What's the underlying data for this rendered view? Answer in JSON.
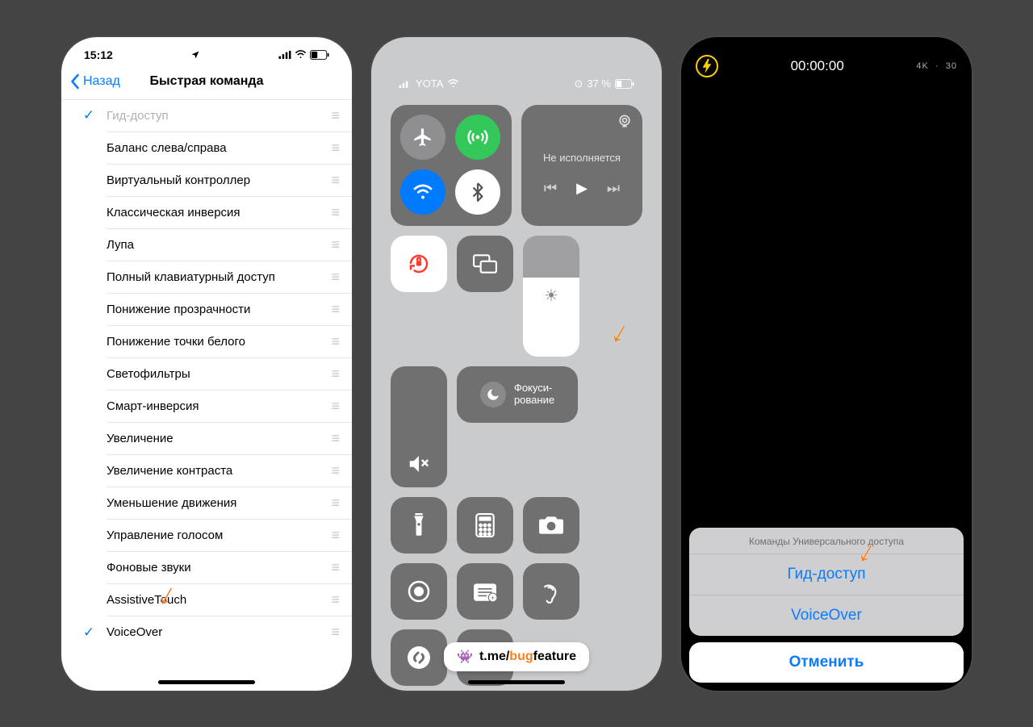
{
  "screen1": {
    "status": {
      "time": "15:12"
    },
    "nav": {
      "back": "Назад",
      "title": "Быстрая команда"
    },
    "items": [
      {
        "checked": true,
        "label": "Гид-доступ"
      },
      {
        "checked": false,
        "label": "Баланс слева/справа"
      },
      {
        "checked": false,
        "label": "Виртуальный контроллер"
      },
      {
        "checked": false,
        "label": "Классическая инверсия"
      },
      {
        "checked": false,
        "label": "Лупа"
      },
      {
        "checked": false,
        "label": "Полный клавиатурный доступ"
      },
      {
        "checked": false,
        "label": "Понижение прозрачности"
      },
      {
        "checked": false,
        "label": "Понижение точки белого"
      },
      {
        "checked": false,
        "label": "Светофильтры"
      },
      {
        "checked": false,
        "label": "Смарт-инверсия"
      },
      {
        "checked": false,
        "label": "Увеличение"
      },
      {
        "checked": false,
        "label": "Увеличение контраста"
      },
      {
        "checked": false,
        "label": "Уменьшение движения"
      },
      {
        "checked": false,
        "label": "Управление голосом"
      },
      {
        "checked": false,
        "label": "Фоновые звуки"
      },
      {
        "checked": false,
        "label": "AssistiveTouch"
      },
      {
        "checked": true,
        "label": "VoiceOver"
      }
    ]
  },
  "screen2": {
    "status": {
      "carrier": "YOTA",
      "battery": "37 %"
    },
    "media": {
      "label": "Не исполняется"
    },
    "focus": {
      "label": "Фокуси-\nрование"
    },
    "badge": {
      "prefix": "t.me/",
      "orange": "bug",
      "suffix": "feature"
    }
  },
  "screen3": {
    "recordTime": "00:00:00",
    "res": "4K",
    "fps": "30",
    "sheet": {
      "header": "Команды Универсального доступа",
      "options": [
        "Гид-доступ",
        "VoiceOver"
      ],
      "cancel": "Отменить"
    }
  }
}
